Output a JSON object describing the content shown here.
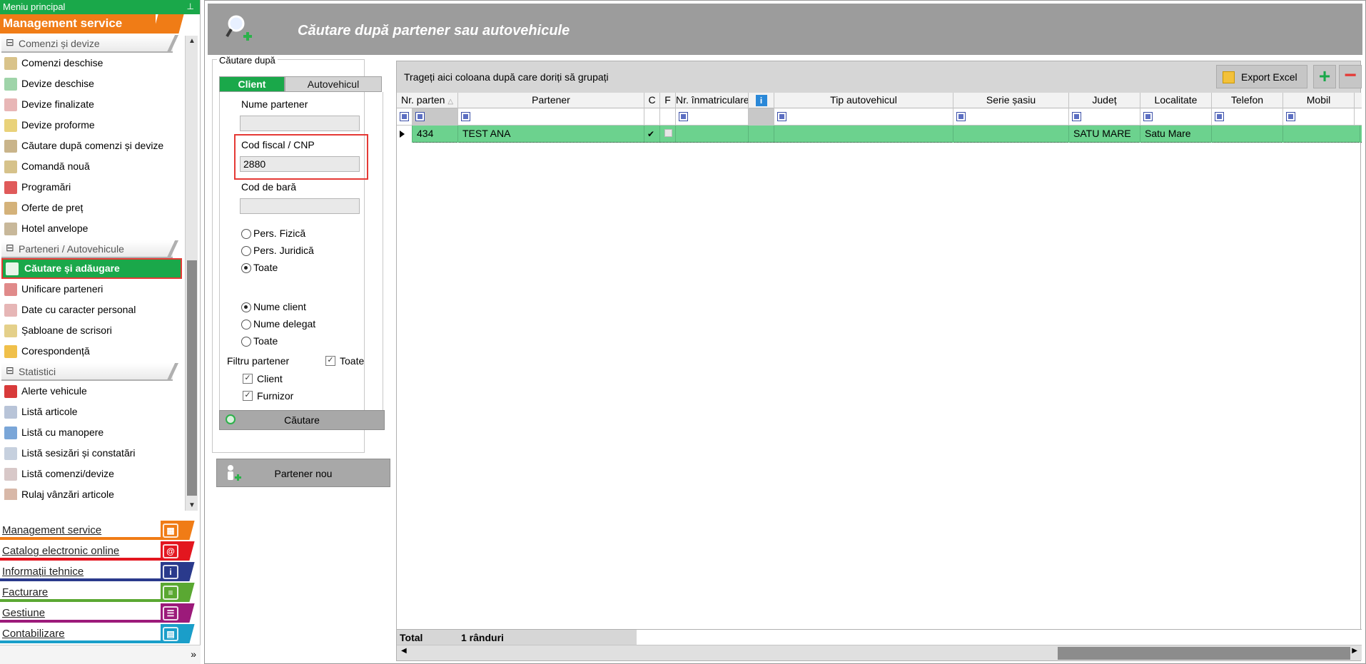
{
  "sidebar": {
    "title": "Meniu principal",
    "pin_icon": "pin-icon",
    "top_module": "Management service",
    "groups": [
      {
        "label": "Comenzi și devize",
        "items": [
          {
            "label": "Comenzi deschise",
            "icon": "orders-icon"
          },
          {
            "label": "Devize deschise",
            "icon": "estimate-open-icon"
          },
          {
            "label": "Devize finalizate",
            "icon": "estimate-done-icon"
          },
          {
            "label": "Devize proforme",
            "icon": "proforma-icon"
          },
          {
            "label": "Căutare după comenzi și devize",
            "icon": "search-orders-icon"
          },
          {
            "label": "Comandă nouă",
            "icon": "new-order-icon"
          },
          {
            "label": "Programări",
            "icon": "appointments-icon"
          },
          {
            "label": "Oferte de preț",
            "icon": "price-offer-icon"
          },
          {
            "label": "Hotel anvelope",
            "icon": "tire-hotel-icon"
          }
        ]
      },
      {
        "label": "Parteneri / Autovehicule",
        "items": [
          {
            "label": "Căutare și adăugare",
            "icon": "search-add-icon",
            "active": true
          },
          {
            "label": "Unificare parteneri",
            "icon": "merge-partners-icon"
          },
          {
            "label": "Date cu caracter personal",
            "icon": "personal-data-icon"
          },
          {
            "label": "Șabloane de scrisori",
            "icon": "letter-templates-icon"
          },
          {
            "label": "Corespondență",
            "icon": "correspondence-icon"
          }
        ]
      },
      {
        "label": "Statistici",
        "items": [
          {
            "label": "Alerte vehicule",
            "icon": "vehicle-alerts-icon"
          },
          {
            "label": "Listă articole",
            "icon": "articles-list-icon"
          },
          {
            "label": "Listă cu manopere",
            "icon": "labor-list-icon"
          },
          {
            "label": "Listă sesizări și constatări",
            "icon": "reports-list-icon"
          },
          {
            "label": "Listă comenzi/devize",
            "icon": "orders-list-icon"
          },
          {
            "label": "Rulaj vânzări articole",
            "icon": "sales-icon"
          }
        ]
      }
    ],
    "modules": [
      {
        "label": "Management service",
        "color": "#f07c16",
        "icon": "service-icon"
      },
      {
        "label": "Catalog electronic online",
        "color": "#e3161f",
        "icon": "at-icon"
      },
      {
        "label": "Informații tehnice",
        "color": "#2a3a8c",
        "icon": "info-book-icon"
      },
      {
        "label": "Facturare",
        "color": "#5aa832",
        "icon": "invoice-icon"
      },
      {
        "label": "Gestiune",
        "color": "#9c1a7a",
        "icon": "inventory-icon"
      },
      {
        "label": "Contabilizare",
        "color": "#1a9ec9",
        "icon": "accounting-icon"
      }
    ],
    "footer_icon": "chevron-double-down-icon"
  },
  "header": {
    "title": "Căutare după partener sau autovehicule",
    "icon": "search-person-add-icon"
  },
  "search_panel": {
    "legend": "Căutare după",
    "tabs": [
      "Client",
      "Autovehicul"
    ],
    "active_tab": "Client",
    "fields": {
      "partner_name_label": "Nume partener",
      "partner_name_value": "",
      "fiscal_code_label": "Cod fiscal / CNP",
      "fiscal_code_value": "2880",
      "barcode_label": "Cod de bară",
      "barcode_value": ""
    },
    "person_type": {
      "options": [
        "Pers. Fizică",
        "Pers. Juridică",
        "Toate"
      ],
      "selected": "Toate"
    },
    "name_type": {
      "options": [
        "Nume client",
        "Nume delegat",
        "Toate"
      ],
      "selected": "Nume client"
    },
    "filter": {
      "label": "Filtru partener",
      "all_label": "Toate",
      "options": [
        "Client",
        "Furnizor"
      ]
    },
    "search_button": "Căutare",
    "new_partner_button": "Partener nou"
  },
  "grid": {
    "group_hint": "Trageți aici coloana după care doriți să grupați",
    "export_button": "Export Excel",
    "add_button": "+",
    "remove_button": "−",
    "columns": [
      "Nr. parten",
      "Partener",
      "C",
      "F",
      "Nr. înmatriculare",
      "",
      "Tip autovehicul",
      "Serie șasiu",
      "Județ",
      "Localitate",
      "Telefon",
      "Mobil"
    ],
    "rows": [
      {
        "nr": "434",
        "partener": "TEST ANA",
        "c": "✔",
        "f": "",
        "nr_inmatriculare": "",
        "tip": "",
        "serie": "",
        "judet": "SATU MARE",
        "localitate": "Satu Mare",
        "telefon": "",
        "mobil": ""
      }
    ],
    "total_label": "Total",
    "total_value": "1 rânduri"
  }
}
